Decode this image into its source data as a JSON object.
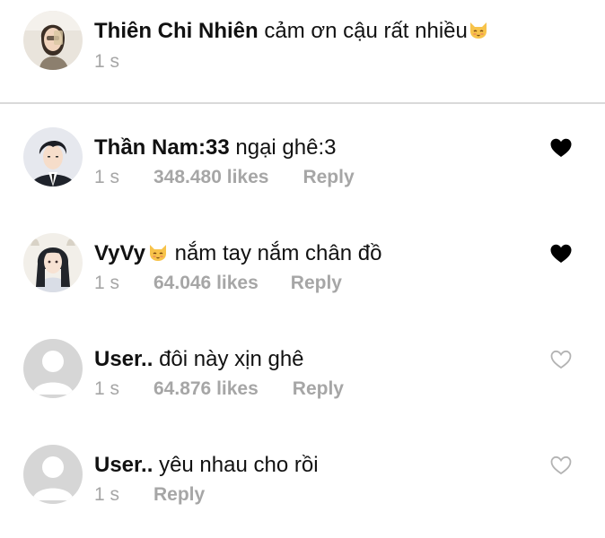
{
  "comments": [
    {
      "username": "Thiên Chi Nhiên",
      "text": "cảm ơn cậu rất nhiều",
      "trailing_emoji": "cat-emoji",
      "time": "1 s",
      "likes": "",
      "reply_label": ""
    },
    {
      "username": "Thần Nam:33",
      "text": "ngại ghê:3",
      "time": "1 s",
      "likes": "348.480 likes",
      "reply_label": "Reply",
      "liked": true
    },
    {
      "username": "VyVy",
      "username_emoji": "cat-emoji",
      "text": "nắm tay nắm chân đồ",
      "time": "1 s",
      "likes": "64.046 likes",
      "reply_label": "Reply",
      "liked": true
    },
    {
      "username": "User..",
      "text": "đôi này xịn ghê",
      "time": "1 s",
      "likes": "64.876 likes",
      "reply_label": "Reply",
      "liked": false
    },
    {
      "username": "User..",
      "text": "yêu nhau cho rồi",
      "time": "1 s",
      "likes": "",
      "reply_label": "Reply",
      "liked": false
    }
  ],
  "colors": {
    "meta_text": "#a6a6a6",
    "main_text": "#111111",
    "divider": "#d9d9d9",
    "heart_filled": "#000000",
    "heart_outline": "#b3b3b3",
    "placeholder_avatar": "#d6d6d6"
  }
}
